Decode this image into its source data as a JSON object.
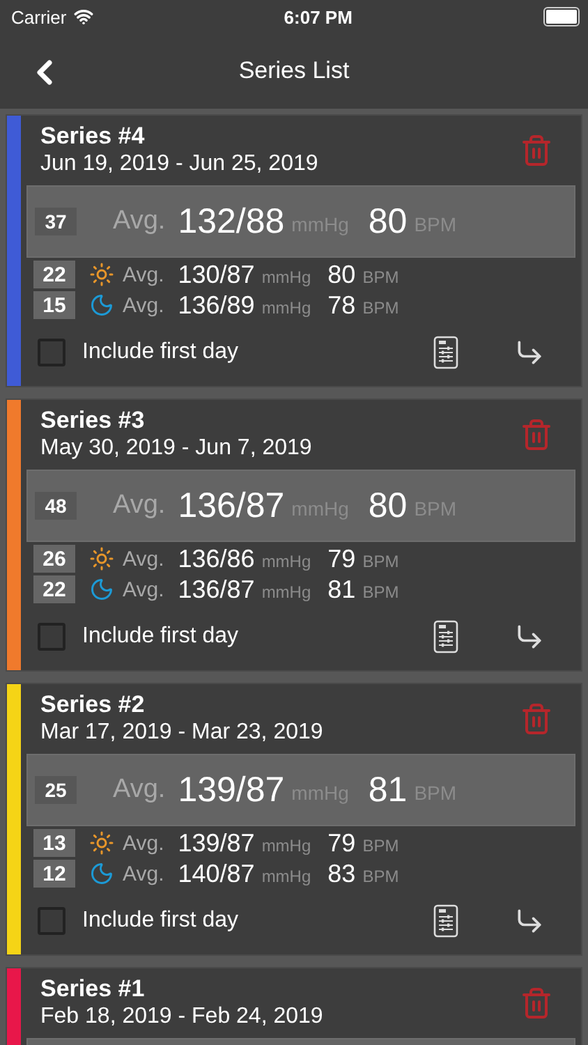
{
  "status_bar": {
    "carrier": "Carrier",
    "time": "6:07 PM"
  },
  "nav": {
    "title": "Series List"
  },
  "series": [
    {
      "title": "Series #4",
      "dates": "Jun 19, 2019 - Jun 25, 2019",
      "color": "#3f5bd6",
      "summary": {
        "count": "37",
        "avg_label": "Avg.",
        "pressure": "132/88",
        "pressure_unit": "mmHg",
        "pulse": "80",
        "pulse_unit": "BPM"
      },
      "periods": [
        {
          "kind": "day",
          "count": "22",
          "avg_label": "Avg.",
          "pressure": "130/87",
          "pressure_unit": "mmHg",
          "pulse": "80",
          "pulse_unit": "BPM"
        },
        {
          "kind": "night",
          "count": "15",
          "avg_label": "Avg.",
          "pressure": "136/89",
          "pressure_unit": "mmHg",
          "pulse": "78",
          "pulse_unit": "BPM"
        }
      ],
      "include_first_day": {
        "label": "Include first day",
        "checked": false
      }
    },
    {
      "title": "Series #3",
      "dates": "May 30, 2019 - Jun 7, 2019",
      "color": "#f07a2c",
      "summary": {
        "count": "48",
        "avg_label": "Avg.",
        "pressure": "136/87",
        "pressure_unit": "mmHg",
        "pulse": "80",
        "pulse_unit": "BPM"
      },
      "periods": [
        {
          "kind": "day",
          "count": "26",
          "avg_label": "Avg.",
          "pressure": "136/86",
          "pressure_unit": "mmHg",
          "pulse": "79",
          "pulse_unit": "BPM"
        },
        {
          "kind": "night",
          "count": "22",
          "avg_label": "Avg.",
          "pressure": "136/87",
          "pressure_unit": "mmHg",
          "pulse": "81",
          "pulse_unit": "BPM"
        }
      ],
      "include_first_day": {
        "label": "Include first day",
        "checked": false
      }
    },
    {
      "title": "Series #2",
      "dates": "Mar 17, 2019 - Mar 23, 2019",
      "color": "#f5d416",
      "summary": {
        "count": "25",
        "avg_label": "Avg.",
        "pressure": "139/87",
        "pressure_unit": "mmHg",
        "pulse": "81",
        "pulse_unit": "BPM"
      },
      "periods": [
        {
          "kind": "day",
          "count": "13",
          "avg_label": "Avg.",
          "pressure": "139/87",
          "pressure_unit": "mmHg",
          "pulse": "79",
          "pulse_unit": "BPM"
        },
        {
          "kind": "night",
          "count": "12",
          "avg_label": "Avg.",
          "pressure": "140/87",
          "pressure_unit": "mmHg",
          "pulse": "83",
          "pulse_unit": "BPM"
        }
      ],
      "include_first_day": {
        "label": "Include first day",
        "checked": false
      }
    },
    {
      "title": "Series #1",
      "dates": "Feb 18, 2019 - Feb 24, 2019",
      "color": "#e8174a"
    }
  ]
}
